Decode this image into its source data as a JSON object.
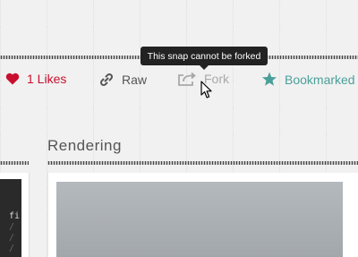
{
  "actions": {
    "likes_label": "1 Likes",
    "raw_label": "Raw",
    "fork_label": "Fork",
    "bookmarked_label": "Bookmarked"
  },
  "tooltip": {
    "text": "This snap cannot be forked"
  },
  "rendering": {
    "title": "Rendering"
  },
  "code": {
    "lines": [
      "fi",
      "/",
      "/",
      "/"
    ]
  },
  "colors": {
    "likes": "#c8102e",
    "bookmarked": "#4a9f9a",
    "fork_disabled": "#a9a9a9",
    "tooltip_bg": "#222222"
  },
  "icons": {
    "likes": "heart-icon",
    "raw": "link-icon",
    "fork": "share-icon",
    "bookmarked": "star-icon"
  }
}
